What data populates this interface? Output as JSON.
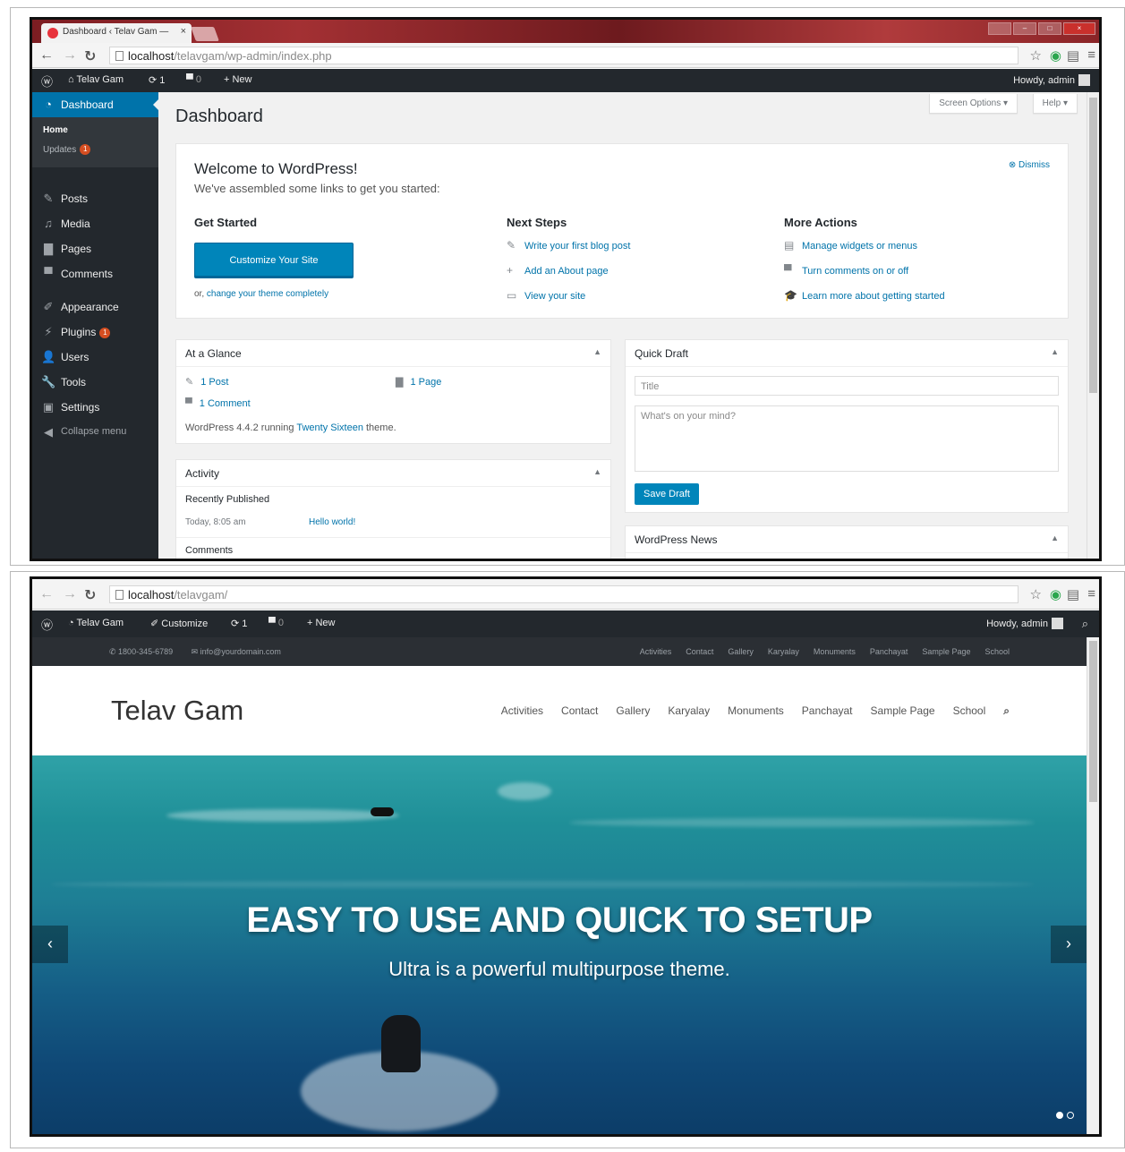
{
  "admin": {
    "tab_title": "Dashboard ‹ Telav Gam —",
    "url_host": "localhost",
    "url_path": "/telavgam/wp-admin/index.php",
    "adminbar": {
      "site_name": "Telav Gam",
      "updates_count": "1",
      "comments_count": "0",
      "new_label": "New",
      "howdy": "Howdy, admin"
    },
    "sidebar": {
      "dashboard": "Dashboard",
      "home": "Home",
      "updates": "Updates",
      "updates_badge": "1",
      "posts": "Posts",
      "media": "Media",
      "pages": "Pages",
      "comments": "Comments",
      "appearance": "Appearance",
      "plugins": "Plugins",
      "plugins_badge": "1",
      "users": "Users",
      "tools": "Tools",
      "settings": "Settings",
      "collapse": "Collapse menu"
    },
    "page_title": "Dashboard",
    "screen_options": "Screen Options ▾",
    "help": "Help ▾",
    "welcome": {
      "title": "Welcome to WordPress!",
      "subtitle": "We've assembled some links to get you started:",
      "dismiss": "Dismiss",
      "get_started": "Get Started",
      "customize_btn": "Customize Your Site",
      "or_text": "or, ",
      "change_theme": "change your theme completely",
      "next_steps": "Next Steps",
      "ns1": "Write your first blog post",
      "ns2": "Add an About page",
      "ns3": "View your site",
      "more_actions": "More Actions",
      "ma1": "Manage widgets or menus",
      "ma2": "Turn comments on or off",
      "ma3": "Learn more about getting started"
    },
    "glance": {
      "title": "At a Glance",
      "posts": "1 Post",
      "pages": "1 Page",
      "comments": "1 Comment",
      "running_pre": "WordPress 4.4.2 running ",
      "theme": "Twenty Sixteen",
      "running_post": " theme."
    },
    "activity": {
      "title": "Activity",
      "recently": "Recently Published",
      "date": "Today, 8:05 am",
      "post": "Hello world!",
      "comments": "Comments"
    },
    "draft": {
      "title": "Quick Draft",
      "title_placeholder": "Title",
      "content_placeholder": "What's on your mind?",
      "save": "Save Draft"
    },
    "news": {
      "title": "WordPress News"
    }
  },
  "site": {
    "url_host": "localhost",
    "url_path": "/telavgam/",
    "adminbar": {
      "site_name": "Telav Gam",
      "customize": "Customize",
      "updates_count": "1",
      "comments_count": "0",
      "new_label": "New",
      "howdy": "Howdy, admin"
    },
    "phone": "1800-345-6789",
    "email": "info@yourdomain.com",
    "top_menu": [
      "Activities",
      "Contact",
      "Gallery",
      "Karyalay",
      "Monuments",
      "Panchayat",
      "Sample Page",
      "School"
    ],
    "logo": "Telav Gam",
    "main_menu": [
      "Activities",
      "Contact",
      "Gallery",
      "Karyalay",
      "Monuments",
      "Panchayat",
      "Sample Page",
      "School"
    ],
    "hero_title": "EASY TO USE AND QUICK TO SETUP",
    "hero_subtitle": "Ultra is a powerful multipurpose theme."
  },
  "colors": {
    "wp_admin_dark": "#23282d",
    "wp_blue": "#0073aa",
    "button_blue": "#0085ba",
    "chrome_red": "#a33033",
    "badge_orange": "#d54e21"
  }
}
